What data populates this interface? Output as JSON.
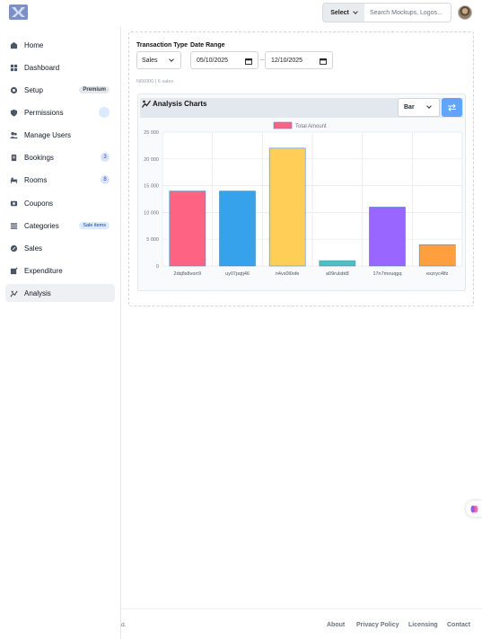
{
  "topbar": {
    "select_label": "Select",
    "search_placeholder": "Search Mockups, Logos..."
  },
  "sidebar": {
    "items": [
      {
        "label": "Home",
        "icon": "home-icon"
      },
      {
        "label": "Dashboard",
        "icon": "dashboard-icon"
      },
      {
        "label": "Setup",
        "icon": "setup-icon",
        "badge": "Premium"
      },
      {
        "label": "Permissions",
        "icon": "shield-icon"
      },
      {
        "label": "Manage Users",
        "icon": "users-icon"
      },
      {
        "label": "Bookings",
        "icon": "bookings-icon",
        "badge": "3"
      },
      {
        "label": "Rooms",
        "icon": "rooms-icon",
        "badge": "8"
      },
      {
        "label": "Coupons",
        "icon": "coupons-icon"
      },
      {
        "label": "Categories",
        "icon": "categories-icon",
        "badge": "Sale items"
      },
      {
        "label": "Sales",
        "icon": "sales-icon"
      },
      {
        "label": "Expenditure",
        "icon": "expenditure-icon"
      },
      {
        "label": "Analysis",
        "icon": "analysis-icon",
        "active": true
      }
    ]
  },
  "filters": {
    "transaction_type_label": "Transaction Type",
    "transaction_type_value": "Sales",
    "date_range_label": "Date Range",
    "date_from": "05/10/2025",
    "date_to": "12/10/2025",
    "separator": "—",
    "summary": "N66000 | 6 sales"
  },
  "chart_panel": {
    "title": "Analysis Charts",
    "chart_type_value": "Bar"
  },
  "chart_data": {
    "type": "bar",
    "categories": [
      "2dq8s8vorr9",
      "uy07pqtj46",
      "n4vs0l0ofe",
      "a09rulsbt8",
      "17n7mouqgq",
      "exzryc4lfz"
    ],
    "series": [
      {
        "name": "Total Amount",
        "values": [
          14000,
          14000,
          22000,
          1000,
          11000,
          4000
        ]
      }
    ],
    "bar_colors": [
      "#ff6384",
      "#36a2eb",
      "#ffce56",
      "#4bc0c0",
      "#9966ff",
      "#ff9f40"
    ],
    "y_ticks": [
      "0",
      "5 000",
      "10 000",
      "15 000",
      "20 000",
      "25 000"
    ],
    "ylim": [
      0,
      25000
    ],
    "legend": "top",
    "grid": true
  },
  "footer": {
    "left_text": "d.",
    "links": [
      "About",
      "Privacy Policy",
      "Licensing",
      "Contact"
    ]
  }
}
